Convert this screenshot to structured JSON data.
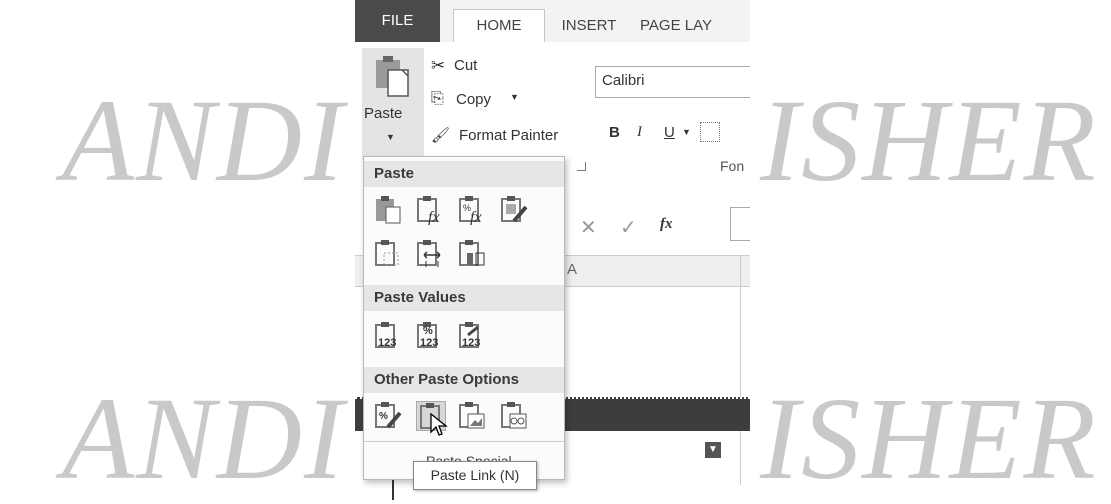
{
  "watermark": {
    "line1": "ANDI",
    "line1b": "ISHER",
    "line2": "ANDI",
    "line2b": "ISHER"
  },
  "tabs": [
    "FILE",
    "HOME",
    "INSERT",
    "PAGE LAY"
  ],
  "clipboard": {
    "paste_label": "Paste",
    "cut_label": "Cut",
    "copy_label": "Copy",
    "format_painter_label": "Format Painter"
  },
  "font": {
    "name": "Calibri",
    "group_label": "Fon",
    "bold": "B",
    "italic": "I",
    "underline": "U"
  },
  "formula_bar": {
    "fx": "fx"
  },
  "column_header": "A",
  "paste_menu": {
    "section_paste": "Paste",
    "section_values": "Paste Values",
    "section_other": "Other Paste Options",
    "paste_special": "Paste Special...",
    "value_badges": [
      "123",
      "123",
      "123"
    ],
    "percent_glyph": "%"
  },
  "tooltip": "Paste Link (N)",
  "colors": {
    "file_tab": "#4a4a4a",
    "menu_header": "#e6e6e6",
    "watermark": "#c9c9c9"
  }
}
